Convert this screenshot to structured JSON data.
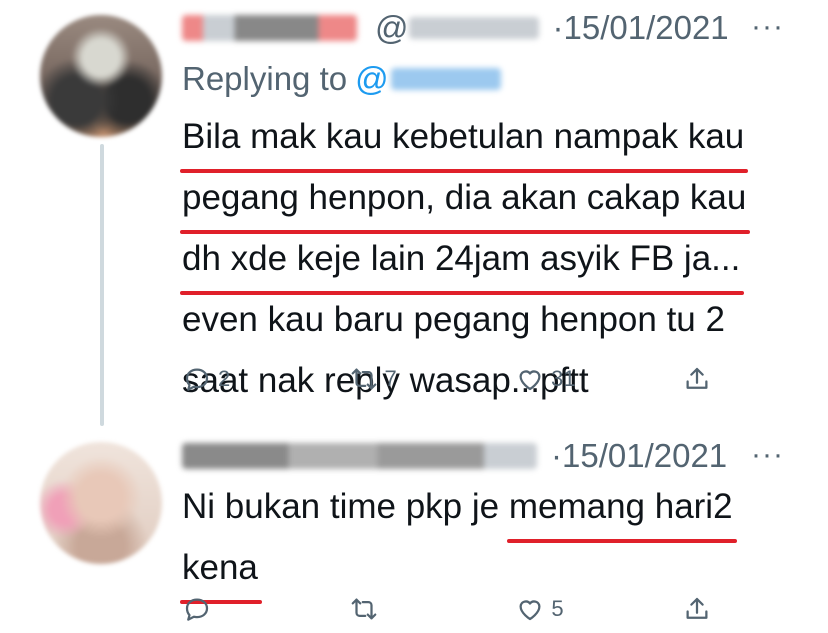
{
  "tweet1": {
    "display_name": "",
    "handle_prefix": "@",
    "date": "·15/01/2021",
    "more": "···",
    "replying_label": "Replying to",
    "replying_at": "@",
    "lines": [
      "Bila mak kau kebetulan nampak kau",
      "pegang henpon, dia akan cakap kau",
      "dh xde keje lain 24jam asyik FB ja...",
      "even kau baru pegang henpon tu 2",
      "saat nak reply wasap...pftt"
    ],
    "reply_count": "2",
    "retweet_count": "7",
    "like_count": "31"
  },
  "tweet2": {
    "date": "·15/01/2021",
    "more": "···",
    "line1_plain": "Ni bukan time pkp je ",
    "line1_underlined": "memang hari2",
    "line2_underlined": "kena",
    "reply_count": "",
    "retweet_count": "",
    "like_count": "5"
  },
  "icons": [
    "reply-icon",
    "retweet-icon",
    "like-icon",
    "share-icon",
    "more-icon"
  ],
  "colors": {
    "underline": "#e0202a",
    "link": "#1d9bf0",
    "secondary": "#536471"
  }
}
